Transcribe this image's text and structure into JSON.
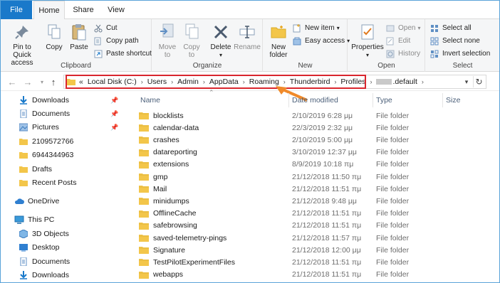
{
  "tabs": {
    "file": "File",
    "home": "Home",
    "share": "Share",
    "view": "View"
  },
  "ribbon": {
    "clipboard": {
      "label": "Clipboard",
      "pin_to_quick_access": "Pin to Quick access",
      "pin_line1": "Pin to Quick",
      "pin_line2": "access",
      "copy": "Copy",
      "paste": "Paste",
      "cut": "Cut",
      "copy_path": "Copy path",
      "paste_shortcut": "Paste shortcut"
    },
    "organize": {
      "label": "Organize",
      "move_to": "Move to",
      "move_line1": "Move",
      "move_line2": "to",
      "copy_to": "Copy to",
      "copy_line1": "Copy",
      "copy_line2": "to",
      "delete": "Delete",
      "rename": "Rename"
    },
    "new": {
      "label": "New",
      "new_folder_line1": "New",
      "new_folder_line2": "folder",
      "new_item": "New item",
      "easy_access": "Easy access"
    },
    "open": {
      "label": "Open",
      "properties": "Properties",
      "open": "Open",
      "edit": "Edit",
      "history": "History"
    },
    "select": {
      "label": "Select",
      "select_all": "Select all",
      "select_none": "Select none",
      "invert_selection": "Invert selection"
    }
  },
  "address": {
    "overflow": "«",
    "crumbs": [
      "Local Disk (C:)",
      "Users",
      "Admin",
      "AppData",
      "Roaming",
      "Thunderbird",
      "Profiles"
    ],
    "last_crumb": ".default"
  },
  "nav": {
    "quick": [
      {
        "label": "Downloads",
        "icon": "download-icon",
        "pinned": true
      },
      {
        "label": "Documents",
        "icon": "documents-icon",
        "pinned": true
      },
      {
        "label": "Pictures",
        "icon": "pictures-icon",
        "pinned": true
      },
      {
        "label": "2109572766",
        "icon": "folder-icon",
        "pinned": false
      },
      {
        "label": "6944344963",
        "icon": "folder-icon",
        "pinned": false
      },
      {
        "label": "Drafts",
        "icon": "folder-icon",
        "pinned": false
      },
      {
        "label": "Recent Posts",
        "icon": "folder-icon",
        "pinned": false
      }
    ],
    "onedrive": "OneDrive",
    "this_pc": "This PC",
    "pc_items": [
      {
        "label": "3D Objects",
        "icon": "cube-icon"
      },
      {
        "label": "Desktop",
        "icon": "desktop-icon"
      },
      {
        "label": "Documents",
        "icon": "documents-icon"
      },
      {
        "label": "Downloads",
        "icon": "download-icon"
      }
    ]
  },
  "columns": {
    "name": "Name",
    "date": "Date modified",
    "type": "Type",
    "size": "Size"
  },
  "files": [
    {
      "name": "blocklists",
      "date": "2/10/2019 6:28 μμ",
      "type": "File folder"
    },
    {
      "name": "calendar-data",
      "date": "22/3/2019 2:32 μμ",
      "type": "File folder"
    },
    {
      "name": "crashes",
      "date": "2/10/2019 5:00 μμ",
      "type": "File folder"
    },
    {
      "name": "datareporting",
      "date": "3/10/2019 12:37 μμ",
      "type": "File folder"
    },
    {
      "name": "extensions",
      "date": "8/9/2019 10:18 πμ",
      "type": "File folder"
    },
    {
      "name": "gmp",
      "date": "21/12/2018 11:50 πμ",
      "type": "File folder"
    },
    {
      "name": "Mail",
      "date": "21/12/2018 11:51 πμ",
      "type": "File folder"
    },
    {
      "name": "minidumps",
      "date": "21/12/2018 9:48 μμ",
      "type": "File folder"
    },
    {
      "name": "OfflineCache",
      "date": "21/12/2018 11:51 πμ",
      "type": "File folder"
    },
    {
      "name": "safebrowsing",
      "date": "21/12/2018 11:51 πμ",
      "type": "File folder"
    },
    {
      "name": "saved-telemetry-pings",
      "date": "21/12/2018 11:57 πμ",
      "type": "File folder"
    },
    {
      "name": "Signature",
      "date": "21/12/2018 12:00 μμ",
      "type": "File folder"
    },
    {
      "name": "TestPilotExperimentFiles",
      "date": "21/12/2018 11:51 πμ",
      "type": "File folder"
    },
    {
      "name": "webapps",
      "date": "21/12/2018 11:51 πμ",
      "type": "File folder"
    }
  ],
  "colors": {
    "accent": "#1979ca",
    "folder": "#f3c64a",
    "highlight": "#d9262e",
    "arrow": "#f08a2a"
  }
}
